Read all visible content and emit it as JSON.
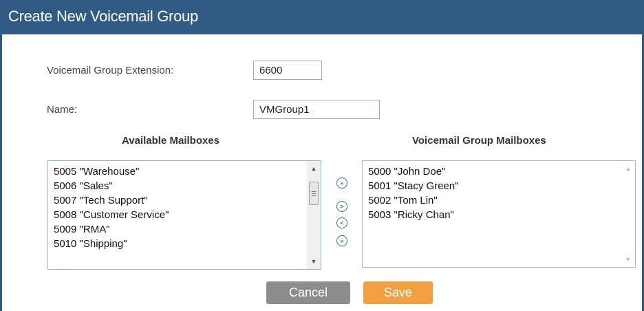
{
  "dialog": {
    "title": "Create New Voicemail Group"
  },
  "form": {
    "extension_label": "Voicemail Group Extension:",
    "extension_value": "6600",
    "name_label": "Name:",
    "name_value": "VMGroup1"
  },
  "available": {
    "title": "Available Mailboxes",
    "items": [
      "5005 \"Warehouse\"",
      "5006 \"Sales\"",
      "5007 \"Tech Support\"",
      "5008 \"Customer Service\"",
      "5009 \"RMA\"",
      "5010 \"Shipping\""
    ]
  },
  "group": {
    "title": "Voicemail Group Mailboxes",
    "items": [
      "5000 \"John Doe\"",
      "5001 \"Stacy Green\"",
      "5002 \"Tom Lin\"",
      "5003 \"Ricky Chan\""
    ]
  },
  "move_buttons": {
    "add_all": "»",
    "add": ">",
    "remove": "<",
    "remove_all": "«"
  },
  "icons": {
    "move_all_right": "double-chevron-right-icon",
    "move_right": "chevron-right-icon",
    "move_left": "chevron-left-icon",
    "move_all_left": "double-chevron-left-icon",
    "scroll_up": "triangle-up-icon",
    "scroll_down": "triangle-down-icon"
  },
  "buttons": {
    "cancel": "Cancel",
    "save": "Save"
  },
  "colors": {
    "header": "#2f5b84",
    "save": "#f0a042",
    "cancel": "#8d8d8d",
    "move_icon": "#3a6fa8"
  }
}
